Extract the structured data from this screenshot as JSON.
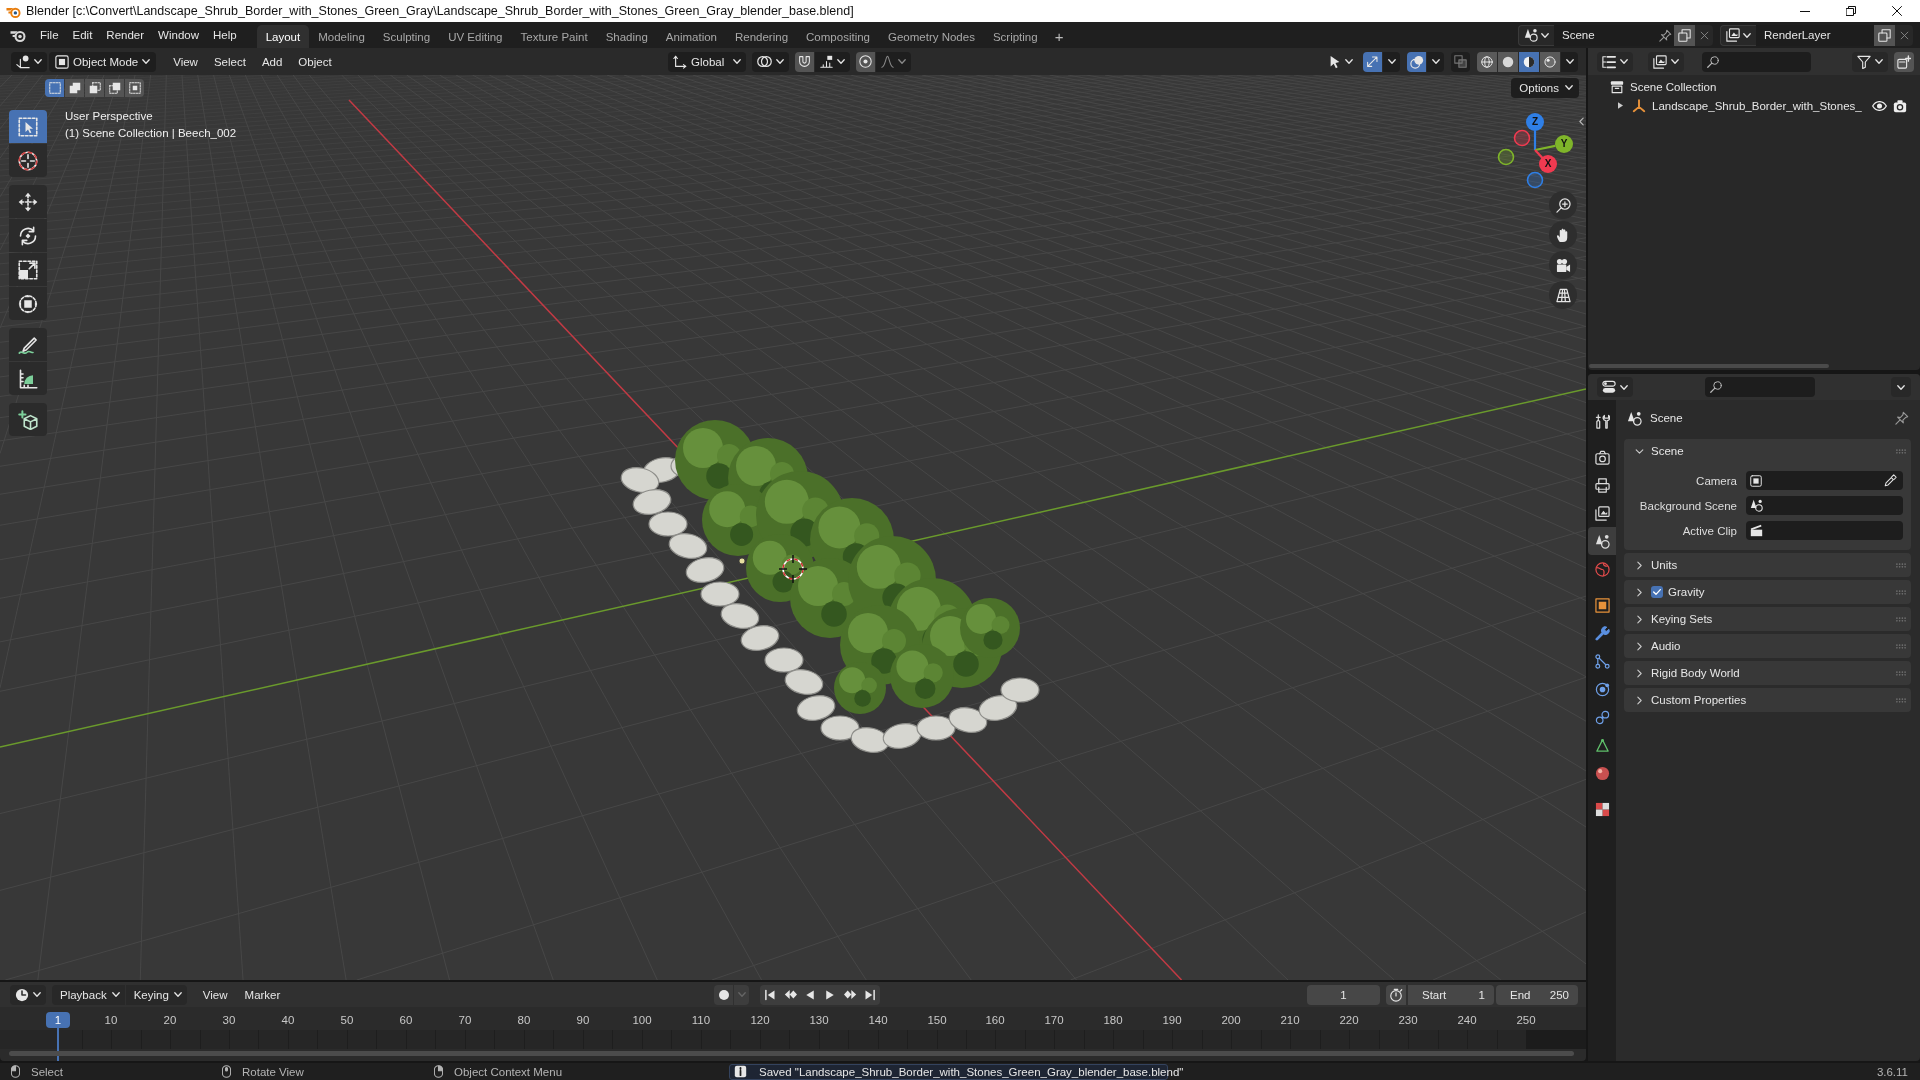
{
  "window": {
    "title": "Blender [c:\\Convert\\Landscape_Shrub_Border_with_Stones_Green_Gray\\Landscape_Shrub_Border_with_Stones_Green_Gray_blender_base.blend]"
  },
  "menu": [
    "File",
    "Edit",
    "Render",
    "Window",
    "Help"
  ],
  "workspaces": [
    {
      "label": "Layout",
      "selected": true
    },
    {
      "label": "Modeling",
      "selected": false
    },
    {
      "label": "Sculpting",
      "selected": false
    },
    {
      "label": "UV Editing",
      "selected": false
    },
    {
      "label": "Texture Paint",
      "selected": false
    },
    {
      "label": "Shading",
      "selected": false
    },
    {
      "label": "Animation",
      "selected": false
    },
    {
      "label": "Rendering",
      "selected": false
    },
    {
      "label": "Compositing",
      "selected": false
    },
    {
      "label": "Geometry Nodes",
      "selected": false
    },
    {
      "label": "Scripting",
      "selected": false
    }
  ],
  "add_workspace": "+",
  "scene": {
    "value": "Scene"
  },
  "view_layer": {
    "value": "RenderLayer"
  },
  "viewport": {
    "mode": "Object Mode",
    "menus": [
      "View",
      "Select",
      "Add",
      "Object"
    ],
    "orientation": "Global",
    "snap": {
      "on": false
    },
    "proportional_editing": {
      "on": false
    },
    "gizmos": {
      "on": true
    },
    "overlays": {
      "on": true
    },
    "xray": {
      "on": false
    },
    "shading": [
      {
        "kind": "wireframe",
        "selected": false
      },
      {
        "kind": "solid",
        "selected": false
      },
      {
        "kind": "material",
        "selected": true
      },
      {
        "kind": "rendered",
        "selected": false
      }
    ],
    "select_modes": [
      {
        "kind": "set",
        "selected": true
      },
      {
        "kind": "extend",
        "selected": false
      },
      {
        "kind": "subtract",
        "selected": false
      },
      {
        "kind": "difference",
        "selected": false
      },
      {
        "kind": "intersect",
        "selected": false
      }
    ],
    "options": "Options",
    "tool_groups": [
      [
        {
          "kind": "select",
          "selected": true
        },
        {
          "kind": "cursor",
          "selected": false
        }
      ],
      [
        {
          "kind": "move",
          "selected": false
        },
        {
          "kind": "rotate",
          "selected": false
        },
        {
          "kind": "scale",
          "selected": false
        },
        {
          "kind": "transform",
          "selected": false
        }
      ],
      [
        {
          "kind": "annotate",
          "selected": false
        },
        {
          "kind": "measure",
          "selected": false
        }
      ],
      [
        {
          "kind": "cube",
          "selected": false
        }
      ]
    ],
    "info": [
      "User Perspective",
      "(1) Scene Collection | Beech_002"
    ],
    "gizmo": [
      {
        "label": "Z",
        "color": "#2f7fe6"
      },
      {
        "label": "Y",
        "color": "#7fb52a"
      },
      {
        "label": "X",
        "color": "#f03a50"
      }
    ]
  },
  "outliner": {
    "root": "Scene Collection",
    "items": [
      {
        "label": "Landscape_Shrub_Border_with_Stones_",
        "expanded": false,
        "visible": true,
        "renderable": true
      }
    ]
  },
  "properties": {
    "tab_groups": [
      [
        {
          "kind": "tool",
          "selected": false
        }
      ],
      [
        {
          "kind": "render",
          "selected": false
        },
        {
          "kind": "output",
          "selected": false
        },
        {
          "kind": "viewlayer",
          "selected": false
        },
        {
          "kind": "scene",
          "selected": true
        },
        {
          "kind": "world",
          "selected": false
        }
      ],
      [
        {
          "kind": "object",
          "selected": false
        },
        {
          "kind": "modifier",
          "selected": false
        },
        {
          "kind": "particles",
          "selected": false
        },
        {
          "kind": "physics",
          "selected": false
        },
        {
          "kind": "constraints",
          "selected": false
        },
        {
          "kind": "data",
          "selected": false
        },
        {
          "kind": "material",
          "selected": false
        }
      ],
      [
        {
          "kind": "texture",
          "selected": false
        }
      ]
    ],
    "context": "Scene",
    "panels": [
      {
        "title": "Scene",
        "expanded": true,
        "fields": [
          {
            "label": "Camera",
            "kind": "object"
          },
          {
            "label": "Background Scene",
            "kind": "scene"
          },
          {
            "label": "Active Clip",
            "kind": "clip"
          }
        ]
      },
      {
        "title": "Units",
        "expanded": false
      },
      {
        "title": "Gravity",
        "expanded": false,
        "checkbox": {
          "checked": true
        }
      },
      {
        "title": "Keying Sets",
        "expanded": false
      },
      {
        "title": "Audio",
        "expanded": false
      },
      {
        "title": "Rigid Body World",
        "expanded": false
      },
      {
        "title": "Custom Properties",
        "expanded": false
      }
    ]
  },
  "timeline": {
    "menus": [
      {
        "label": "Playback",
        "kind": "dropdown"
      },
      {
        "label": "Keying",
        "kind": "dropdown"
      },
      {
        "label": "View",
        "kind": "menu"
      },
      {
        "label": "Marker",
        "kind": "menu"
      }
    ],
    "auto_keying": {
      "on": false
    },
    "current_frame": "1",
    "start": {
      "label": "Start",
      "value": "1"
    },
    "end": {
      "label": "End",
      "value": "250"
    },
    "playhead": "1",
    "ticks": [
      "10",
      "20",
      "30",
      "40",
      "50",
      "60",
      "70",
      "80",
      "90",
      "100",
      "110",
      "120",
      "130",
      "140",
      "150",
      "160",
      "170",
      "180",
      "190",
      "200",
      "210",
      "220",
      "230",
      "240",
      "250"
    ]
  },
  "status_bar": {
    "hints": [
      {
        "kind": "left",
        "label": "Select"
      },
      {
        "kind": "middle",
        "label": "Rotate View"
      },
      {
        "kind": "right",
        "label": "Object Context Menu"
      }
    ],
    "message": "Saved \"Landscape_Shrub_Border_with_Stones_Green_Gray_blender_base.blend\"",
    "version": "3.6.11"
  }
}
